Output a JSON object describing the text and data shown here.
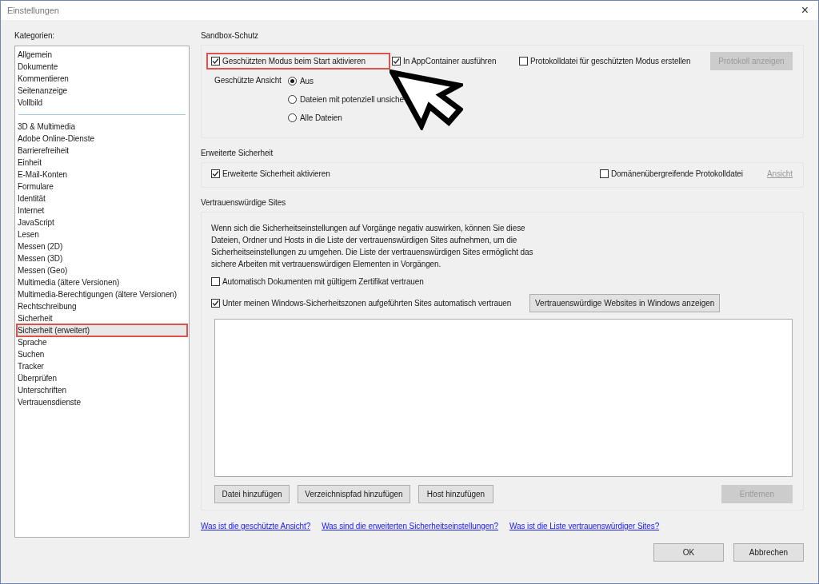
{
  "window": {
    "title": "Einstellungen",
    "close": "×"
  },
  "categories": {
    "label": "Kategorien:",
    "groups": [
      {
        "items": [
          {
            "label": "Allgemein",
            "selected": false
          },
          {
            "label": "Dokumente",
            "selected": false
          },
          {
            "label": "Kommentieren",
            "selected": false
          },
          {
            "label": "Seitenanzeige",
            "selected": false
          },
          {
            "label": "Vollbild",
            "selected": false
          }
        ]
      },
      {
        "items": [
          {
            "label": "3D & Multimedia",
            "selected": false
          },
          {
            "label": "Adobe Online-Dienste",
            "selected": false
          },
          {
            "label": "Barrierefreiheit",
            "selected": false
          },
          {
            "label": "Einheit",
            "selected": false
          },
          {
            "label": "E-Mail-Konten",
            "selected": false
          },
          {
            "label": "Formulare",
            "selected": false
          },
          {
            "label": "Identität",
            "selected": false
          },
          {
            "label": "Internet",
            "selected": false
          },
          {
            "label": "JavaScript",
            "selected": false
          },
          {
            "label": "Lesen",
            "selected": false
          },
          {
            "label": "Messen (2D)",
            "selected": false
          },
          {
            "label": "Messen (3D)",
            "selected": false
          },
          {
            "label": "Messen (Geo)",
            "selected": false
          },
          {
            "label": "Multimedia (ältere Versionen)",
            "selected": false
          },
          {
            "label": "Multimedia-Berechtigungen (ältere Versionen)",
            "selected": false
          },
          {
            "label": "Rechtschreibung",
            "selected": false
          },
          {
            "label": "Sicherheit",
            "selected": false
          },
          {
            "label": "Sicherheit (erweitert)",
            "selected": true
          },
          {
            "label": "Sprache",
            "selected": false
          },
          {
            "label": "Suchen",
            "selected": false
          },
          {
            "label": "Tracker",
            "selected": false
          },
          {
            "label": "Überprüfen",
            "selected": false
          },
          {
            "label": "Unterschriften",
            "selected": false
          },
          {
            "label": "Vertrauensdienste",
            "selected": false
          }
        ]
      }
    ]
  },
  "sandbox": {
    "title": "Sandbox-Schutz",
    "checkboxes": [
      {
        "label": "Geschützten Modus beim Start aktivieren",
        "checked": true,
        "highlighted": true
      },
      {
        "label": "In AppContainer ausführen",
        "checked": true,
        "highlighted": false
      },
      {
        "label": "Protokolldatei für geschützten Modus erstellen",
        "checked": false,
        "highlighted": false
      }
    ],
    "log_button": {
      "label": "Protokoll anzeigen",
      "disabled": true
    },
    "protected_view": {
      "label": "Geschützte Ansicht",
      "options": [
        {
          "label": "Aus",
          "selected": true
        },
        {
          "label": "Dateien mit potenziell unsiche",
          "selected": false
        },
        {
          "label": "Alle Dateien",
          "selected": false
        }
      ]
    }
  },
  "enhanced": {
    "title": "Erweiterte Sicherheit",
    "checkboxes": [
      {
        "label": "Erweiterte Sicherheit aktivieren",
        "checked": true
      },
      {
        "label": "Domänenübergreifende Protokolldatei",
        "checked": false
      }
    ],
    "view_link": {
      "label": "Ansicht",
      "disabled": true
    }
  },
  "trusted": {
    "title": "Vertrauenswürdige Sites",
    "description": "Wenn sich die Sicherheitseinstellungen auf Vorgänge negativ auswirken,  können Sie diese Dateien, Ordner und Hosts in die Liste der vertrauenswürdigen Sites aufnehmen, um die Sicherheitseinstellungen zu umgehen. Die Liste der vertrauenswürdigen Sites ermöglicht das sichere Arbeiten mit vertrauenswürdigen Elementen in Vorgängen.",
    "checkboxes": [
      {
        "label": "Automatisch Dokumenten mit gültigem Zertifikat vertrauen",
        "checked": false
      },
      {
        "label": "Unter meinen Windows-Sicherheitszonen aufgeführten Sites automatisch vertrauen",
        "checked": true
      }
    ],
    "windows_button": {
      "label": "Vertrauenswürdige Websites in Windows anzeigen",
      "disabled": false
    },
    "buttons": [
      {
        "label": "Datei hinzufügen",
        "disabled": false
      },
      {
        "label": "Verzeichnispfad hinzufügen",
        "disabled": false
      },
      {
        "label": "Host hinzufügen",
        "disabled": false
      },
      {
        "label": "Entfernen",
        "disabled": true
      }
    ]
  },
  "help_links": [
    "Was ist die geschützte Ansicht?",
    "Was sind die erweiterten Sicherheitseinstellungen?",
    "Was ist die Liste vertrauenswürdiger Sites?"
  ],
  "footer_buttons": [
    "OK",
    "Abbrechen"
  ]
}
